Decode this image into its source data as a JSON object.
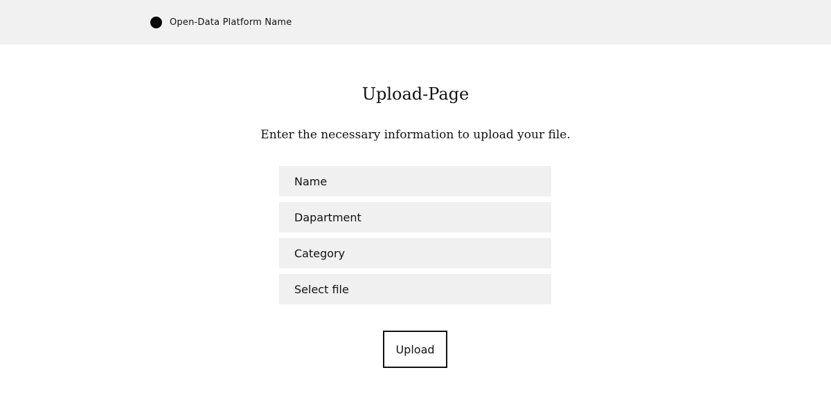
{
  "header": {
    "logo_icon": "filled-circle-icon",
    "platform_name": "Open-Data Platform Name"
  },
  "main": {
    "title": "Upload-Page",
    "subtitle": "Enter the necessary information to upload your file."
  },
  "form": {
    "name_placeholder": "Name",
    "department_placeholder": "Dapartment",
    "category_placeholder": "Category",
    "file_label": "Select file",
    "upload_label": "Upload"
  },
  "colors": {
    "header_background": "#f1f1f1",
    "field_background": "#f0f0f0",
    "text": "#111111",
    "page_background": "#ffffff"
  }
}
